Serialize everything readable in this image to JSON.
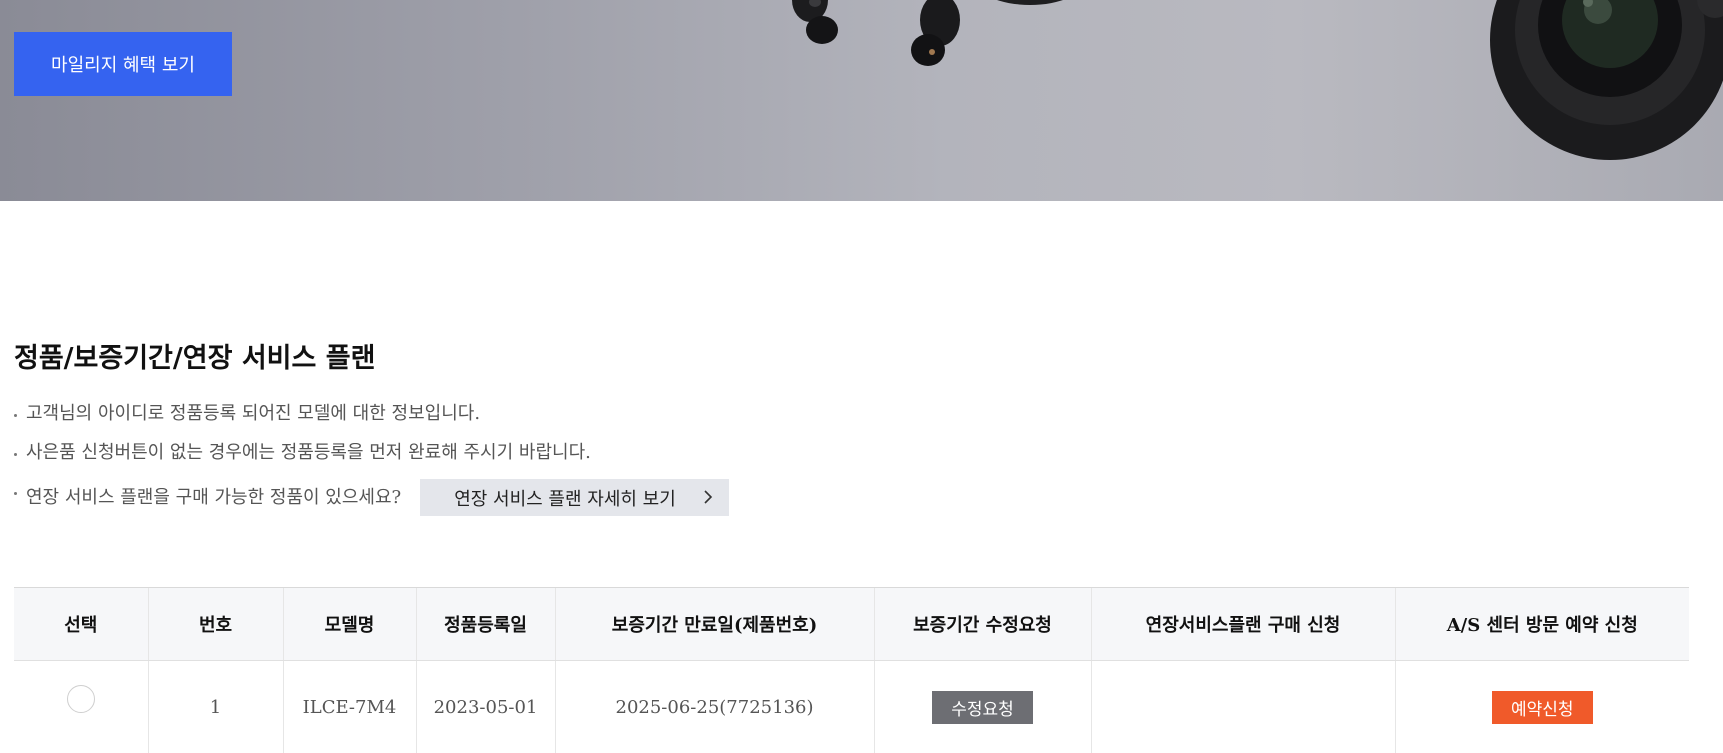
{
  "banner": {
    "mileage_button": "마일리지 혜택 보기"
  },
  "section": {
    "title": "정품/보증기간/연장 서비스 플랜",
    "notes": [
      "고객님의 아이디로 정품등록 되어진 모델에 대한 정보입니다.",
      "사은품 신청버튼이 없는 경우에는 정품등록을 먼저 완료해 주시기 바랍니다.",
      "연장 서비스 플랜을 구매 가능한 정품이 있으세요?"
    ],
    "plan_button": "연장 서비스 플랜 자세히 보기"
  },
  "table": {
    "headers": [
      "선택",
      "번호",
      "모델명",
      "정품등록일",
      "보증기간 만료일(제품번호)",
      "보증기간 수정요청",
      "연장서비스플랜 구매 신청",
      "A/S 센터 방문 예약 신청"
    ],
    "rows": [
      {
        "number": "1",
        "model": "ILCE-7M4",
        "registered": "2023-05-01",
        "expiry": "2025-06-25(7725136)",
        "modify_button": "수정요청",
        "extension": "",
        "reserve_button": "예약신청"
      }
    ]
  },
  "colors": {
    "banner_button": "#3563f0",
    "modify_button": "#6d6e73",
    "reserve_button": "#f05a2a",
    "header_bg": "#f6f7f9"
  },
  "icons": {
    "plan_button": "chevron-right-icon",
    "row_select": "radio-icon"
  }
}
